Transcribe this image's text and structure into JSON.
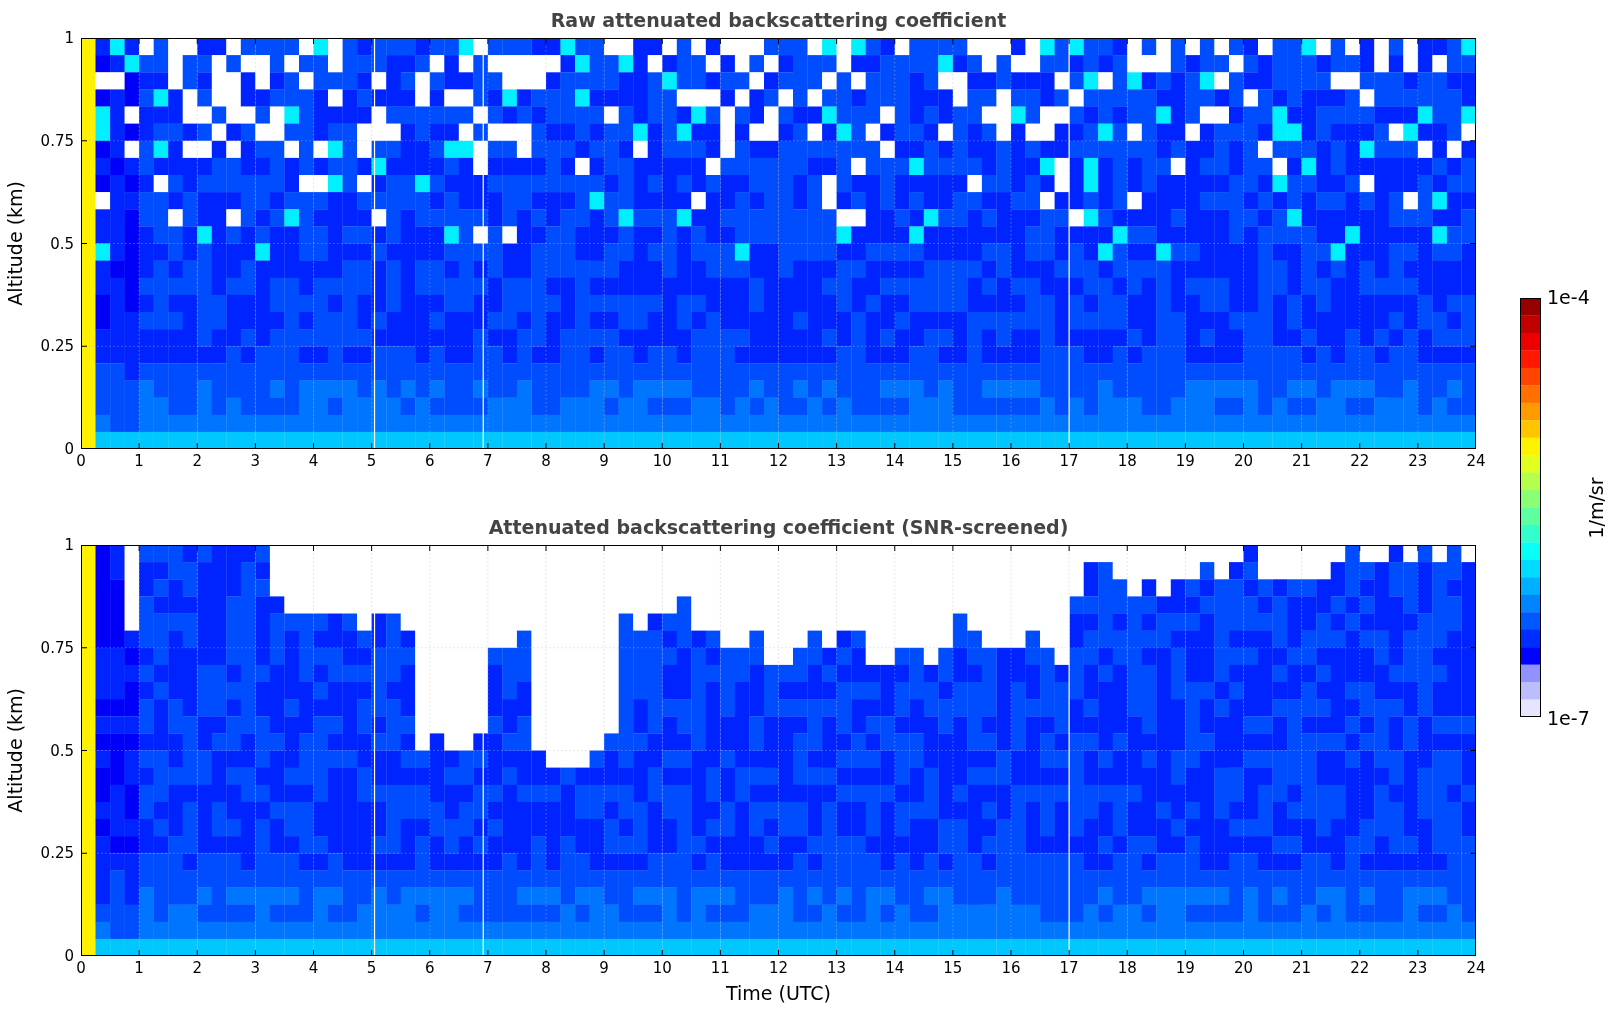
{
  "plots": [
    {
      "kind": "raw",
      "title": "Raw attenuated backscattering coefficient",
      "ylabel": "Altitude (km)",
      "yticks": [
        "1",
        "0.75",
        "0.5",
        "0.25",
        "0"
      ],
      "xticks": [
        "0",
        "1",
        "2",
        "3",
        "4",
        "5",
        "6",
        "7",
        "8",
        "9",
        "10",
        "11",
        "12",
        "13",
        "14",
        "15",
        "16",
        "17",
        "18",
        "19",
        "20",
        "21",
        "22",
        "23",
        "24"
      ]
    },
    {
      "kind": "screened",
      "title": "Attenuated backscattering coefficient (SNR-screened)",
      "ylabel": "Altitude (km)",
      "yticks": [
        "1",
        "0.75",
        "0.5",
        "0.25",
        "0"
      ],
      "xticks": [
        "0",
        "1",
        "2",
        "3",
        "4",
        "5",
        "6",
        "7",
        "8",
        "9",
        "10",
        "11",
        "12",
        "13",
        "14",
        "15",
        "16",
        "17",
        "18",
        "19",
        "20",
        "21",
        "22",
        "23",
        "24"
      ],
      "xlabel": "Time (UTC)"
    }
  ],
  "colorbar": {
    "max": "1e-4",
    "min": "1e-7",
    "label": "1/m/sr"
  }
}
